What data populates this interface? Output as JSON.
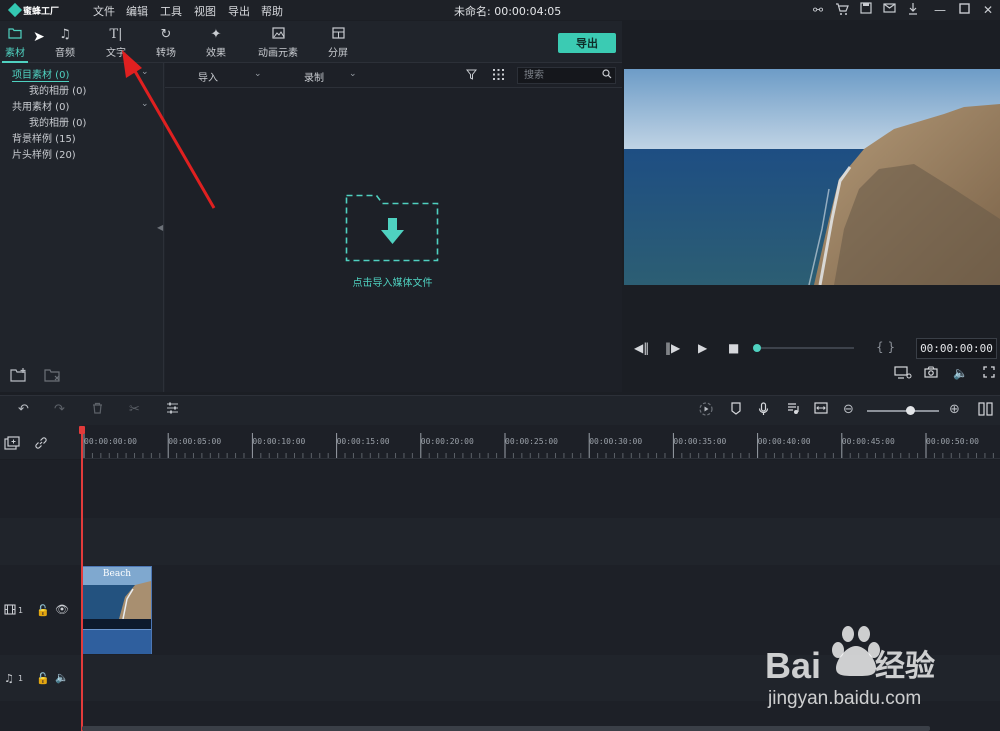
{
  "app": {
    "logo_text": "蜜蜂工厂",
    "project_title": "未命名: 00:00:04:05"
  },
  "menu": [
    "文件",
    "编辑",
    "工具",
    "视图",
    "导出",
    "帮助"
  ],
  "window_icons": [
    "user-icon",
    "cart-icon",
    "save-icon",
    "mail-icon",
    "download-icon",
    "minimize-icon",
    "maximize-icon",
    "close-icon"
  ],
  "tabs": [
    {
      "label": "素材",
      "icon": "folder-icon",
      "active": true
    },
    {
      "label": "音频",
      "icon": "music-note-icon"
    },
    {
      "label": "文字",
      "icon": "text-icon"
    },
    {
      "label": "转场",
      "icon": "transition-icon"
    },
    {
      "label": "效果",
      "icon": "effects-icon"
    },
    {
      "label": "动画元素",
      "icon": "image-icon"
    },
    {
      "label": "分屏",
      "icon": "split-screen-icon"
    }
  ],
  "export_label": "导出",
  "tree": [
    {
      "label": "项目素材 (0)",
      "selected": true,
      "expandable": true
    },
    {
      "label": "我的相册 (0)",
      "indent": true
    },
    {
      "label": "共用素材 (0)",
      "expandable": true
    },
    {
      "label": "我的相册 (0)",
      "indent": true
    },
    {
      "label": "背景样例 (15)"
    },
    {
      "label": "片头样例 (20)"
    }
  ],
  "browser": {
    "import_label": "导入",
    "record_label": "录制",
    "search_placeholder": "搜索",
    "drop_label": "点击导入媒体文件"
  },
  "preview": {
    "timecode": "00:00:00:00",
    "brackets": "{ }",
    "progress": 0
  },
  "timeline": {
    "ticks": [
      "00:00:00:00",
      "00:00:05:00",
      "00:00:10:00",
      "00:00:15:00",
      "00:00:20:00",
      "00:00:25:00",
      "00:00:30:00",
      "00:00:35:00",
      "00:00:40:00",
      "00:00:45:00",
      "00:00:50:00"
    ],
    "video_track_num": "1",
    "audio_track_num": "1",
    "clip_title": "Beach"
  },
  "watermark": {
    "brand": "Baidu经验",
    "url": "jingyan.baidu.com"
  },
  "colors": {
    "accent": "#4fd1c0",
    "export_button": "#3bcbb3",
    "playhead": "#e23b3b",
    "annotation_arrow": "#e02020"
  }
}
